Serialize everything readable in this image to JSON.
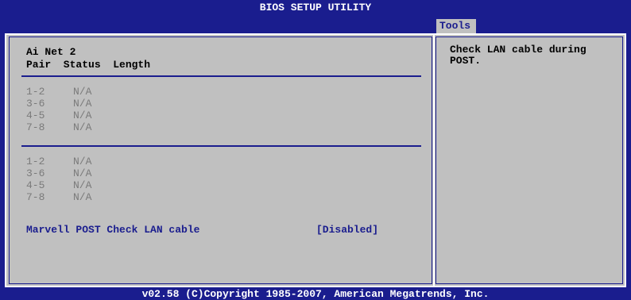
{
  "header": {
    "title": "BIOS SETUP UTILITY",
    "tab": "Tools"
  },
  "main": {
    "section_title": "Ai Net 2",
    "columns": "Pair  Status  Length",
    "group1": [
      {
        "pair": "1-2",
        "status": "N/A"
      },
      {
        "pair": "3-6",
        "status": "N/A"
      },
      {
        "pair": "4-5",
        "status": "N/A"
      },
      {
        "pair": "7-8",
        "status": "N/A"
      }
    ],
    "group2": [
      {
        "pair": "1-2",
        "status": "N/A"
      },
      {
        "pair": "3-6",
        "status": "N/A"
      },
      {
        "pair": "4-5",
        "status": "N/A"
      },
      {
        "pair": "7-8",
        "status": "N/A"
      }
    ],
    "option": {
      "label": "Marvell POST Check LAN cable",
      "value": "[Disabled]"
    }
  },
  "help": {
    "text": "Check LAN cable during POST."
  },
  "footer": {
    "text": "v02.58 (C)Copyright 1985-2007, American Megatrends, Inc."
  },
  "colors": {
    "background": "#1a1d8e",
    "panel": "#c0c0c0",
    "highlight_text": "#1a1d8e",
    "disabled_text": "#7a7a7a"
  }
}
